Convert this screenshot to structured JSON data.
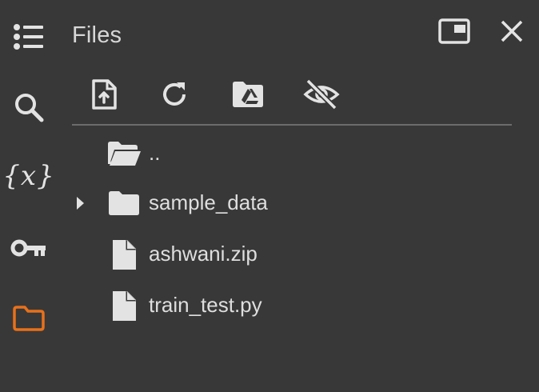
{
  "panel": {
    "title": "Files"
  },
  "rail": {
    "items": [
      {
        "name": "table-of-contents",
        "icon": "list-icon"
      },
      {
        "name": "find-and-replace",
        "icon": "search-icon"
      },
      {
        "name": "variables",
        "icon": "variables-icon",
        "label": "{x}"
      },
      {
        "name": "secrets",
        "icon": "key-icon"
      },
      {
        "name": "files",
        "icon": "folder-icon",
        "active": true
      }
    ]
  },
  "header": {
    "buttons": [
      {
        "name": "move-to-tab",
        "icon": "window-icon"
      },
      {
        "name": "close",
        "icon": "close-icon"
      }
    ]
  },
  "toolbar": {
    "buttons": [
      {
        "name": "upload",
        "icon": "upload-file-icon"
      },
      {
        "name": "refresh",
        "icon": "refresh-icon"
      },
      {
        "name": "mount-drive",
        "icon": "drive-folder-icon"
      },
      {
        "name": "toggle-hidden",
        "icon": "eye-off-icon"
      }
    ]
  },
  "tree": {
    "items": [
      {
        "label": "..",
        "icon": "folder-open-icon",
        "type": "parent"
      },
      {
        "label": "sample_data",
        "icon": "folder-icon",
        "type": "folder",
        "expandable": true
      },
      {
        "label": "ashwani.zip",
        "icon": "file-icon",
        "type": "file"
      },
      {
        "label": "train_test.py",
        "icon": "file-icon",
        "type": "file"
      }
    ]
  },
  "colors": {
    "background": "#383838",
    "icon": "#e3e3e3",
    "accent": "#e8711a",
    "divider": "#6c6c6c"
  }
}
